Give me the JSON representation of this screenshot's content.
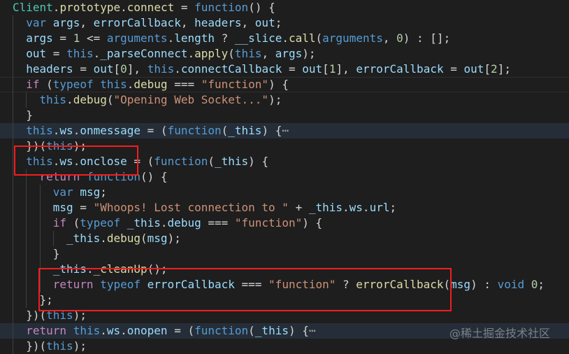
{
  "colors": {
    "background": "#1e1e1e",
    "highlight": "#252e38",
    "annotation": "#f41d1d"
  },
  "watermark": "@稀土掘金技术社区",
  "lines": [
    {
      "indent": 0,
      "tokens": [
        [
          "Client",
          "t"
        ],
        [
          ".",
          "p"
        ],
        [
          "prototype",
          "f"
        ],
        [
          ".",
          "p"
        ],
        [
          "connect",
          "f"
        ],
        [
          " = ",
          "p"
        ],
        [
          "function",
          "k"
        ],
        [
          "() {",
          "p"
        ]
      ]
    },
    {
      "indent": 1,
      "tokens": [
        [
          "var",
          "k"
        ],
        [
          " ",
          "p"
        ],
        [
          "args",
          "v"
        ],
        [
          ", ",
          "p"
        ],
        [
          "errorCallback",
          "v"
        ],
        [
          ", ",
          "p"
        ],
        [
          "headers",
          "v"
        ],
        [
          ", ",
          "p"
        ],
        [
          "out",
          "v"
        ],
        [
          ";",
          "p"
        ]
      ]
    },
    {
      "indent": 1,
      "tokens": [
        [
          "args",
          "v"
        ],
        [
          " = ",
          "p"
        ],
        [
          "1",
          "n"
        ],
        [
          " <= ",
          "p"
        ],
        [
          "arguments",
          "k"
        ],
        [
          ".",
          "p"
        ],
        [
          "length",
          "v"
        ],
        [
          " ? ",
          "p"
        ],
        [
          "__slice",
          "v"
        ],
        [
          ".",
          "p"
        ],
        [
          "call",
          "f"
        ],
        [
          "(",
          "p"
        ],
        [
          "arguments",
          "k"
        ],
        [
          ", ",
          "p"
        ],
        [
          "0",
          "n"
        ],
        [
          ") : [];",
          "p"
        ]
      ]
    },
    {
      "indent": 1,
      "tokens": [
        [
          "out",
          "v"
        ],
        [
          " = ",
          "p"
        ],
        [
          "this",
          "k"
        ],
        [
          ".",
          "p"
        ],
        [
          "_parseConnect",
          "v"
        ],
        [
          ".",
          "p"
        ],
        [
          "apply",
          "f"
        ],
        [
          "(",
          "p"
        ],
        [
          "this",
          "k"
        ],
        [
          ", ",
          "p"
        ],
        [
          "args",
          "v"
        ],
        [
          ");",
          "p"
        ]
      ]
    },
    {
      "indent": 1,
      "tokens": [
        [
          "headers",
          "v"
        ],
        [
          " = ",
          "p"
        ],
        [
          "out",
          "v"
        ],
        [
          "[",
          "p"
        ],
        [
          "0",
          "n"
        ],
        [
          "], ",
          "p"
        ],
        [
          "this",
          "k"
        ],
        [
          ".",
          "p"
        ],
        [
          "connectCallback",
          "v"
        ],
        [
          " = ",
          "p"
        ],
        [
          "out",
          "v"
        ],
        [
          "[",
          "p"
        ],
        [
          "1",
          "n"
        ],
        [
          "], ",
          "p"
        ],
        [
          "errorCallback",
          "v"
        ],
        [
          " = ",
          "p"
        ],
        [
          "out",
          "v"
        ],
        [
          "[",
          "p"
        ],
        [
          "2",
          "n"
        ],
        [
          "];",
          "p"
        ]
      ]
    },
    {
      "indent": 1,
      "current": true,
      "tokens": [
        [
          "if",
          "c"
        ],
        [
          " (",
          "p"
        ],
        [
          "typeof",
          "k"
        ],
        [
          " ",
          "p"
        ],
        [
          "this",
          "k"
        ],
        [
          ".",
          "p"
        ],
        [
          "debug",
          "f"
        ],
        [
          " === ",
          "p"
        ],
        [
          "\"function\"",
          "s"
        ],
        [
          ") {",
          "p"
        ]
      ]
    },
    {
      "indent": 2,
      "tokens": [
        [
          "this",
          "k"
        ],
        [
          ".",
          "p"
        ],
        [
          "debug",
          "f"
        ],
        [
          "(",
          "p"
        ],
        [
          "\"Opening Web Socket...\"",
          "s"
        ],
        [
          ");",
          "p"
        ]
      ]
    },
    {
      "indent": 1,
      "tokens": [
        [
          "}",
          "p"
        ]
      ]
    },
    {
      "indent": 1,
      "highlight": true,
      "tokens": [
        [
          "this",
          "k"
        ],
        [
          ".",
          "p"
        ],
        [
          "ws",
          "v"
        ],
        [
          ".",
          "p"
        ],
        [
          "onmessage",
          "v"
        ],
        [
          " = (",
          "p"
        ],
        [
          "function",
          "k"
        ],
        [
          "(",
          "p"
        ],
        [
          "_this",
          "v"
        ],
        [
          ") {",
          "p"
        ],
        [
          "⋯",
          "fold"
        ]
      ]
    },
    {
      "indent": 1,
      "tokens": [
        [
          "})(",
          "p"
        ],
        [
          "this",
          "k"
        ],
        [
          ");",
          "p"
        ]
      ]
    },
    {
      "indent": 1,
      "tokens": [
        [
          "this",
          "k"
        ],
        [
          ".",
          "p"
        ],
        [
          "ws",
          "v"
        ],
        [
          ".",
          "p"
        ],
        [
          "onclose",
          "v"
        ],
        [
          " = (",
          "p"
        ],
        [
          "function",
          "k"
        ],
        [
          "(",
          "p"
        ],
        [
          "_this",
          "v"
        ],
        [
          ") {",
          "p"
        ]
      ]
    },
    {
      "indent": 2,
      "tokens": [
        [
          "return",
          "c"
        ],
        [
          " ",
          "p"
        ],
        [
          "function",
          "k"
        ],
        [
          "() {",
          "p"
        ]
      ]
    },
    {
      "indent": 3,
      "tokens": [
        [
          "var",
          "k"
        ],
        [
          " ",
          "p"
        ],
        [
          "msg",
          "v"
        ],
        [
          ";",
          "p"
        ]
      ]
    },
    {
      "indent": 3,
      "tokens": [
        [
          "msg",
          "v"
        ],
        [
          " = ",
          "p"
        ],
        [
          "\"Whoops! Lost connection to \"",
          "s"
        ],
        [
          " + ",
          "p"
        ],
        [
          "_this",
          "v"
        ],
        [
          ".",
          "p"
        ],
        [
          "ws",
          "v"
        ],
        [
          ".",
          "p"
        ],
        [
          "url",
          "v"
        ],
        [
          ";",
          "p"
        ]
      ]
    },
    {
      "indent": 3,
      "tokens": [
        [
          "if",
          "c"
        ],
        [
          " (",
          "p"
        ],
        [
          "typeof",
          "k"
        ],
        [
          " ",
          "p"
        ],
        [
          "_this",
          "v"
        ],
        [
          ".",
          "p"
        ],
        [
          "debug",
          "v"
        ],
        [
          " === ",
          "p"
        ],
        [
          "\"function\"",
          "s"
        ],
        [
          ") {",
          "p"
        ]
      ]
    },
    {
      "indent": 4,
      "tokens": [
        [
          "_this",
          "v"
        ],
        [
          ".",
          "p"
        ],
        [
          "debug",
          "f"
        ],
        [
          "(",
          "p"
        ],
        [
          "msg",
          "v"
        ],
        [
          ");",
          "p"
        ]
      ]
    },
    {
      "indent": 3,
      "tokens": [
        [
          "}",
          "p"
        ]
      ]
    },
    {
      "indent": 3,
      "tokens": [
        [
          "_this",
          "v"
        ],
        [
          ".",
          "p"
        ],
        [
          "_cleanUp",
          "f"
        ],
        [
          "();",
          "p"
        ]
      ]
    },
    {
      "indent": 3,
      "tokens": [
        [
          "return",
          "c"
        ],
        [
          " ",
          "p"
        ],
        [
          "typeof",
          "k"
        ],
        [
          " ",
          "p"
        ],
        [
          "errorCallback",
          "v"
        ],
        [
          " === ",
          "p"
        ],
        [
          "\"function\"",
          "s"
        ],
        [
          " ? ",
          "p"
        ],
        [
          "errorCallback",
          "f"
        ],
        [
          "(",
          "p"
        ],
        [
          "msg",
          "v"
        ],
        [
          ") : ",
          "p"
        ],
        [
          "void",
          "k"
        ],
        [
          " ",
          "p"
        ],
        [
          "0",
          "n"
        ],
        [
          ";",
          "p"
        ]
      ]
    },
    {
      "indent": 2,
      "tokens": [
        [
          "};",
          "p"
        ]
      ]
    },
    {
      "indent": 1,
      "tokens": [
        [
          "})(",
          "p"
        ],
        [
          "this",
          "k"
        ],
        [
          ");",
          "p"
        ]
      ]
    },
    {
      "indent": 1,
      "highlight": true,
      "tokens": [
        [
          "return",
          "c"
        ],
        [
          " ",
          "p"
        ],
        [
          "this",
          "k"
        ],
        [
          ".",
          "p"
        ],
        [
          "ws",
          "v"
        ],
        [
          ".",
          "p"
        ],
        [
          "onopen",
          "v"
        ],
        [
          " = (",
          "p"
        ],
        [
          "function",
          "k"
        ],
        [
          "(",
          "p"
        ],
        [
          "_this",
          "v"
        ],
        [
          ") {",
          "p"
        ],
        [
          "⋯",
          "fold"
        ]
      ]
    },
    {
      "indent": 1,
      "tokens": [
        [
          "})(",
          "p"
        ],
        [
          "this",
          "k"
        ],
        [
          ");",
          "p"
        ]
      ]
    }
  ]
}
